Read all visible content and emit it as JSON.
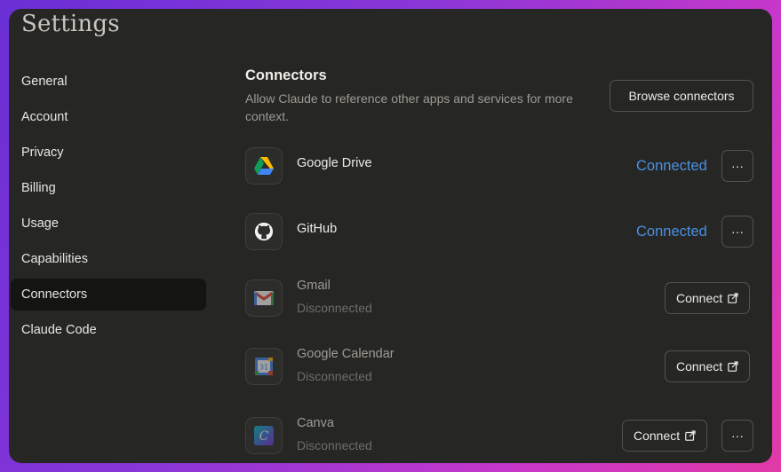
{
  "window": {
    "title": "Settings"
  },
  "nav": {
    "items": [
      {
        "label": "General"
      },
      {
        "label": "Account"
      },
      {
        "label": "Privacy"
      },
      {
        "label": "Billing"
      },
      {
        "label": "Usage"
      },
      {
        "label": "Capabilities"
      },
      {
        "label": "Connectors",
        "active": true
      },
      {
        "label": "Claude Code"
      }
    ]
  },
  "connectors": {
    "title": "Connectors",
    "description": "Allow Claude to reference other apps and services for more context.",
    "browse_label": "Browse connectors",
    "items": [
      {
        "name": "Google Drive",
        "icon": "google-drive-icon",
        "status": "Connected"
      },
      {
        "name": "GitHub",
        "icon": "github-icon",
        "status": "Connected"
      },
      {
        "name": "Gmail",
        "icon": "gmail-icon",
        "status": "Disconnected",
        "action": "Connect"
      },
      {
        "name": "Google Calendar",
        "icon": "google-calendar-icon",
        "status": "Disconnected",
        "action": "Connect"
      },
      {
        "name": "Canva",
        "icon": "canva-icon",
        "status": "Disconnected",
        "action": "Connect"
      }
    ],
    "more_label": "···",
    "calendar_day": "31",
    "canva_letter": "C"
  },
  "colors": {
    "accent": "#4a90e2",
    "panel": "#262624",
    "active_nav": "#141413"
  }
}
